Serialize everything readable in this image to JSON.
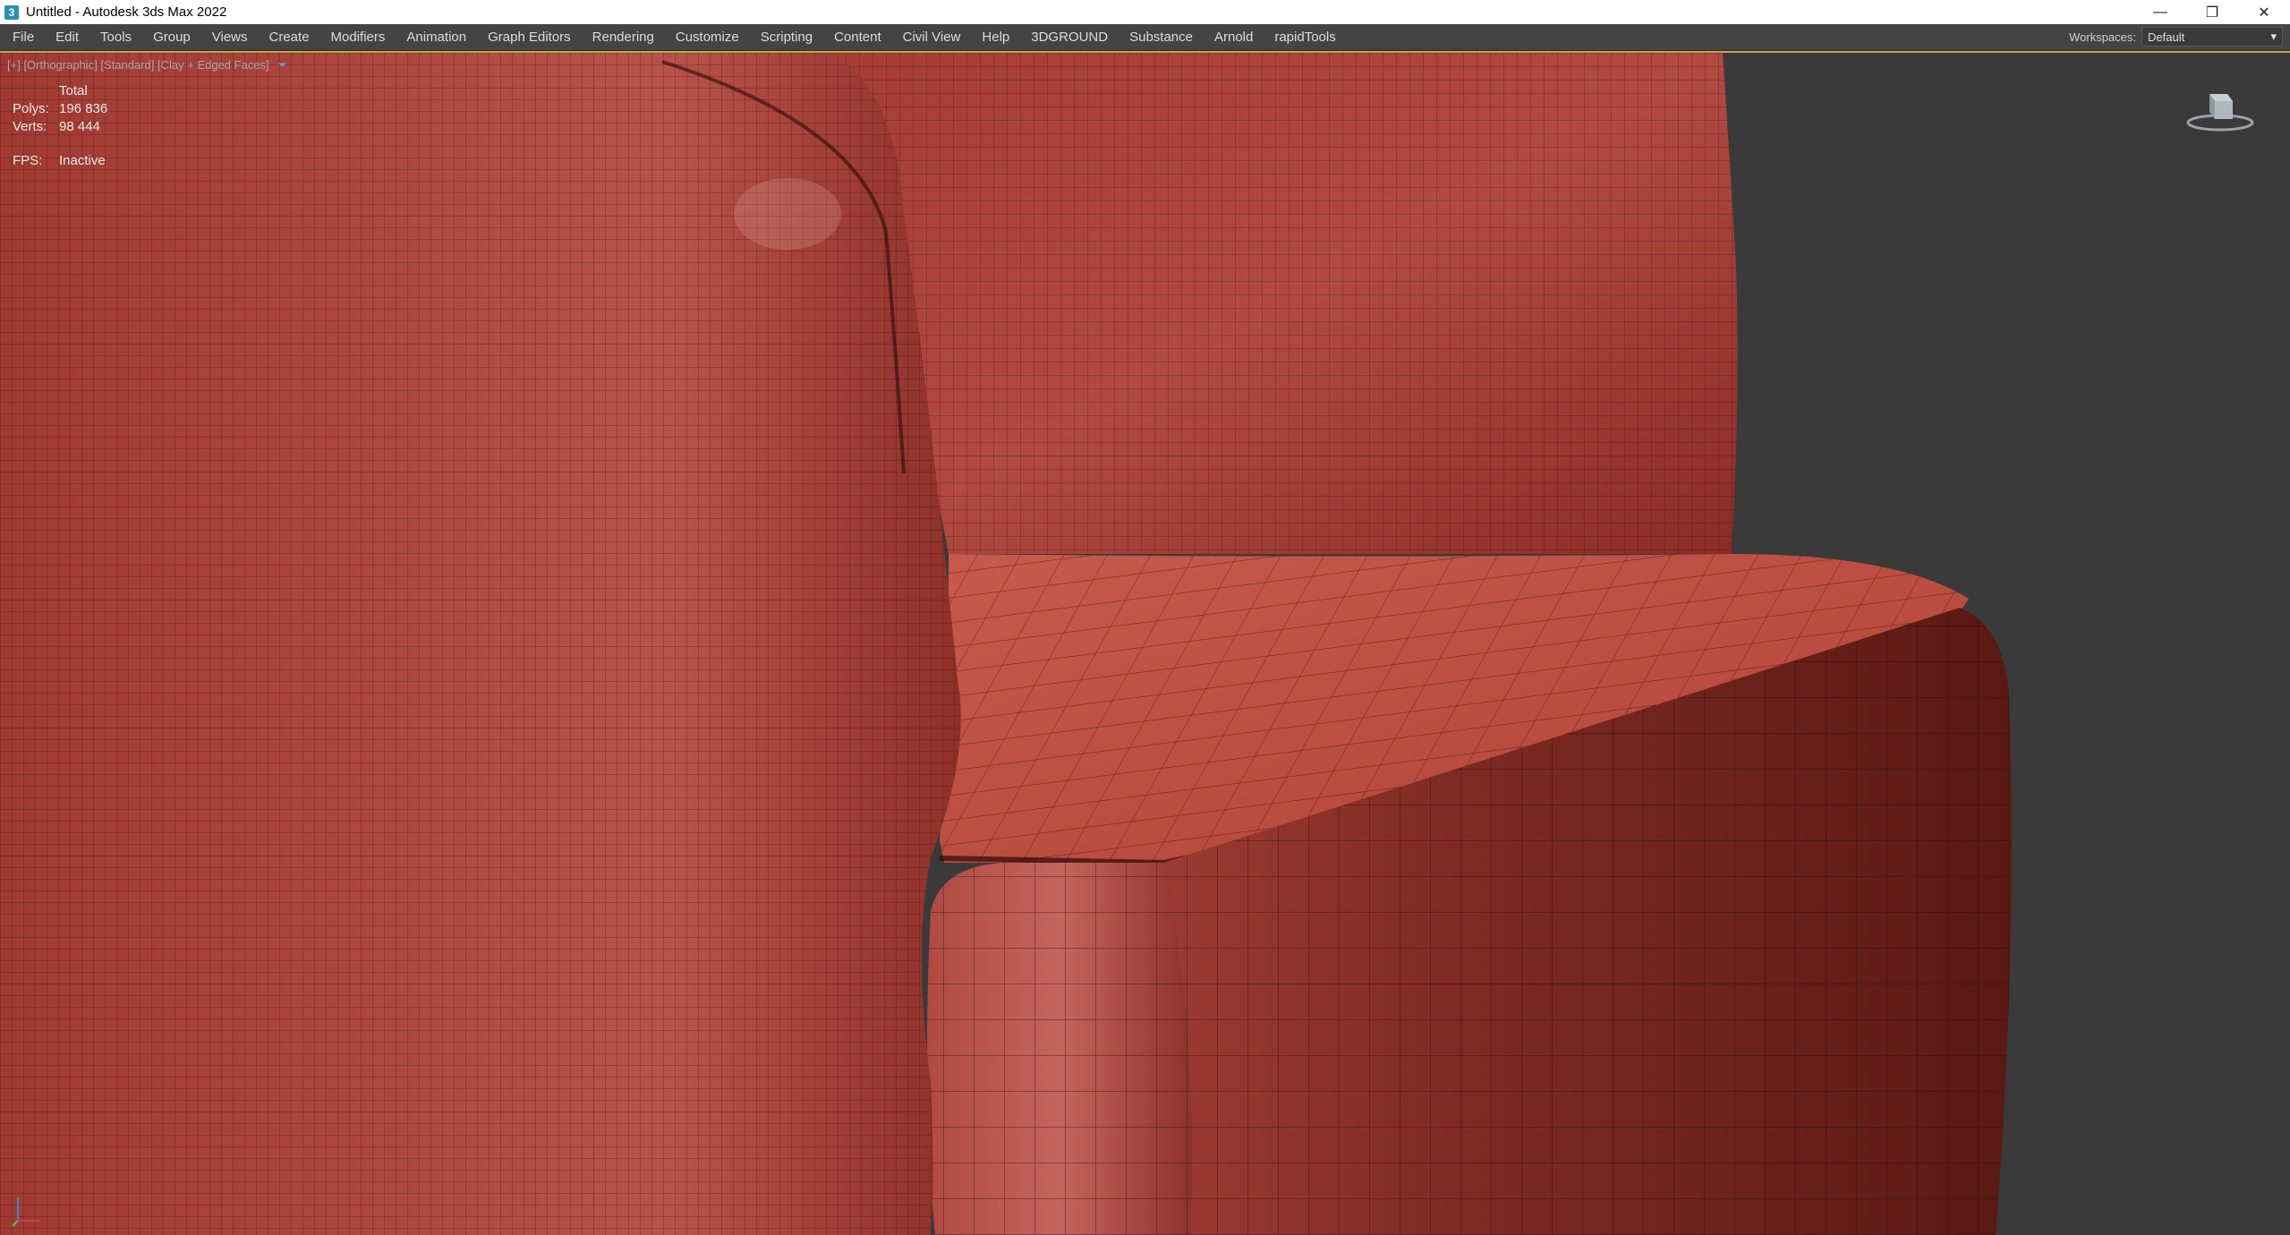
{
  "window": {
    "title": "Untitled - Autodesk 3ds Max 2022",
    "app_icon_letter": "3",
    "controls": {
      "minimize": "—",
      "restore": "❐",
      "close": "✕"
    }
  },
  "menu": {
    "items": [
      "File",
      "Edit",
      "Tools",
      "Group",
      "Views",
      "Create",
      "Modifiers",
      "Animation",
      "Graph Editors",
      "Rendering",
      "Customize",
      "Scripting",
      "Content",
      "Civil View",
      "Help",
      "3DGROUND",
      "Substance",
      "Arnold",
      "rapidTools"
    ]
  },
  "workspaces": {
    "label": "Workspaces:",
    "value": "Default",
    "arrow": "▾"
  },
  "viewport": {
    "label": "[+] [Orthographic] [Standard] [Clay + Edged Faces]",
    "filter_icon": "funnel-icon",
    "accent_color": "#c9a64a",
    "mesh_color": "#b5453c",
    "stats": {
      "header": "Total",
      "polys_label": "Polys:",
      "polys_value": "196 836",
      "verts_label": "Verts:",
      "verts_value": "98 444",
      "fps_label": "FPS:",
      "fps_value": "Inactive"
    }
  }
}
